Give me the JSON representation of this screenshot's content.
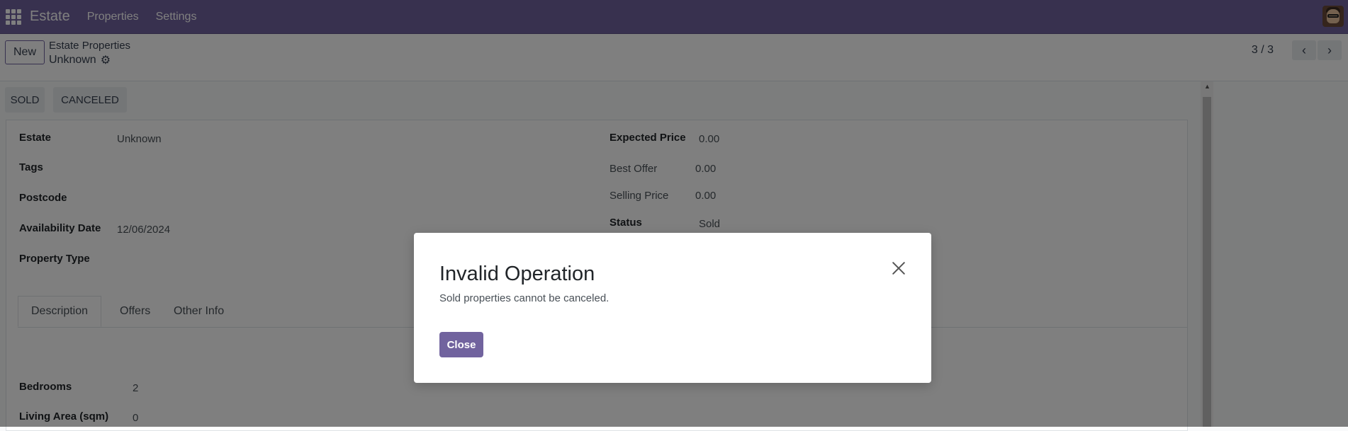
{
  "navbar": {
    "app_name": "Estate",
    "menu": [
      "Properties",
      "Settings"
    ]
  },
  "control": {
    "new_label": "New",
    "breadcrumb_parent": "Estate Properties",
    "breadcrumb_current": "Unknown",
    "pager": "3 / 3"
  },
  "statusbar": {
    "buttons": [
      "SOLD",
      "CANCELED"
    ]
  },
  "form": {
    "left": [
      {
        "label": "Estate",
        "value": "Unknown"
      },
      {
        "label": "Tags",
        "value": ""
      },
      {
        "label": "Postcode",
        "value": ""
      },
      {
        "label": "Availability Date",
        "value": "12/06/2024"
      },
      {
        "label": "Property Type",
        "value": ""
      }
    ],
    "right": [
      {
        "label": "Expected Price",
        "value": "0.00"
      },
      {
        "label": "Best Offer",
        "value": "0.00"
      },
      {
        "label": "Selling Price",
        "value": "0.00"
      },
      {
        "label": "Status",
        "value": "Sold"
      }
    ],
    "tabs": [
      "Description",
      "Offers",
      "Other Info"
    ],
    "details": [
      {
        "label": "Bedrooms",
        "value": "2"
      },
      {
        "label": "Living Area (sqm)",
        "value": "0"
      }
    ]
  },
  "dialog": {
    "title": "Invalid Operation",
    "message": "Sold properties cannot be canceled.",
    "button": "Close"
  },
  "colors": {
    "brand": "#71639e"
  }
}
